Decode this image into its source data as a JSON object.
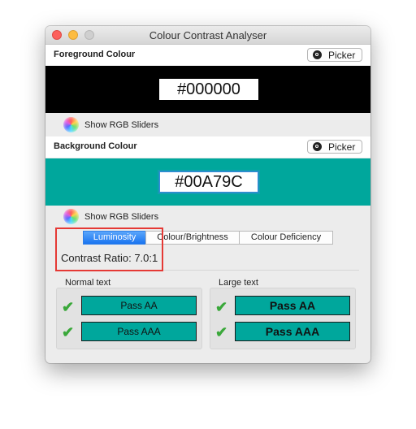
{
  "window": {
    "title": "Colour Contrast Analyser"
  },
  "foreground": {
    "label": "Foreground Colour",
    "picker_label": "Picker",
    "hex": "#000000",
    "color": "#000000",
    "sliders_label": "Show RGB Sliders"
  },
  "background": {
    "label": "Background Colour",
    "picker_label": "Picker",
    "hex": "#00A79C",
    "color": "#00A79C",
    "sliders_label": "Show RGB Sliders"
  },
  "tabs": [
    {
      "label": "Luminosity",
      "active": true
    },
    {
      "label": "Colour/Brightness",
      "active": false
    },
    {
      "label": "Colour Deficiency",
      "active": false
    }
  ],
  "contrast_ratio": "Contrast Ratio: 7.0:1",
  "normal_text": {
    "label": "Normal text",
    "results": [
      {
        "label": "Pass AA",
        "icon": "checkmark-icon"
      },
      {
        "label": "Pass AAA",
        "icon": "checkmark-icon"
      }
    ]
  },
  "large_text": {
    "label": "Large text",
    "results": [
      {
        "label": "Pass AA",
        "icon": "checkmark-icon"
      },
      {
        "label": "Pass AAA",
        "icon": "checkmark-icon"
      }
    ]
  },
  "colors": {
    "pass": "#00A79C",
    "check": "#3aa83a",
    "highlight": "#e53935",
    "active_tab": "#1a74f0"
  }
}
